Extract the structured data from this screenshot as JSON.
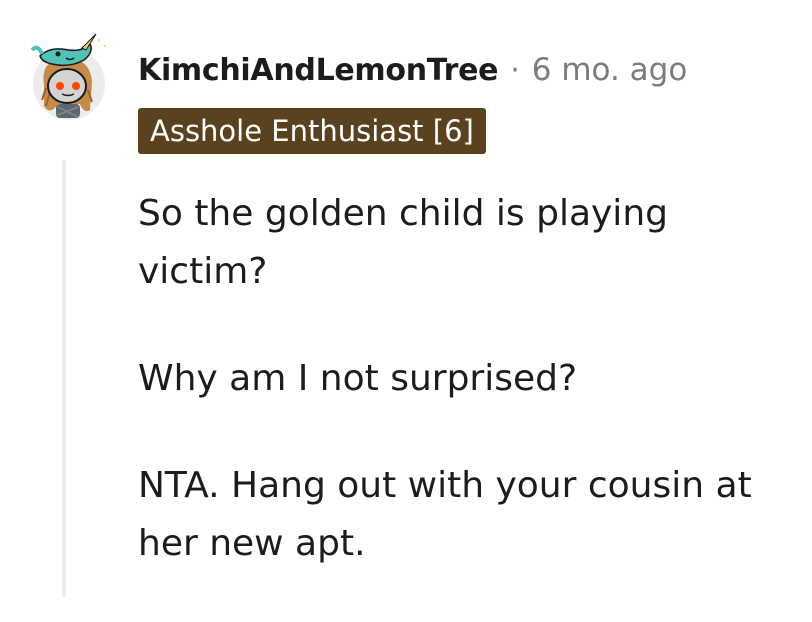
{
  "comment": {
    "username": "KimchiAndLemonTree",
    "separator": "·",
    "timestamp": "6 mo. ago",
    "flair": "Asshole Enthusiast [6]",
    "paragraphs": [
      "So the golden child is playing victim?",
      "Why am I not surprised?",
      "NTA. Hang out with your cousin at her new apt."
    ]
  },
  "colors": {
    "flair_background": "#5a421f",
    "thread_line": "#ececec",
    "meta_text": "#7c7c7c",
    "body_text": "#1c1c1c"
  },
  "icons": {
    "avatar": "snoo-avatar-with-narwhal-hat"
  }
}
